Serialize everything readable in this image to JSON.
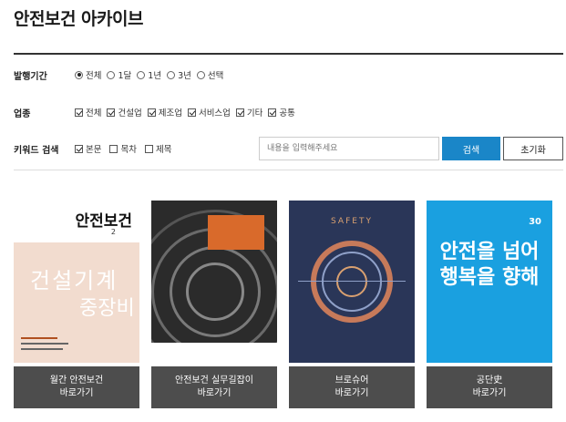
{
  "page_title": "안전보건 아카이브",
  "filters": {
    "period": {
      "label": "발행기간",
      "options": [
        "전체",
        "1달",
        "1년",
        "3년",
        "선택"
      ],
      "selected": "전체"
    },
    "industry": {
      "label": "업종",
      "options": [
        "전체",
        "건설업",
        "제조업",
        "서비스업",
        "기타",
        "공통"
      ]
    },
    "keyword": {
      "label": "키워드 검색",
      "options": [
        "본문",
        "목차",
        "제목"
      ],
      "checked": [
        "본문"
      ],
      "placeholder": "내용을 입력해주세요",
      "search_label": "검색",
      "reset_label": "초기화"
    }
  },
  "cards": [
    {
      "title": "월간 안전보건",
      "action": "바로가기",
      "cover_title": "안전보건",
      "cover_num": "2",
      "cover_text": "건설기계",
      "cover_text2": "중장비"
    },
    {
      "title": "안전보건 실무길잡이",
      "action": "바로가기"
    },
    {
      "title": "브로슈어",
      "action": "바로가기",
      "cover_text": "SAFETY"
    },
    {
      "title": "공단史",
      "action": "바로가기",
      "cover_text": "안전을 넘어",
      "cover_text2": "행복을 향해",
      "cover_badge": "30"
    }
  ],
  "colors": {
    "primary": "#1a86c8",
    "card_button": "#4d4d4d"
  }
}
